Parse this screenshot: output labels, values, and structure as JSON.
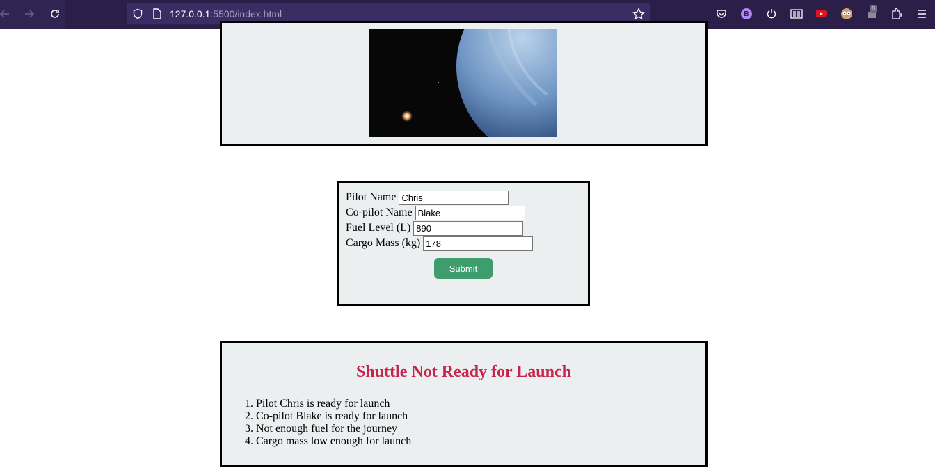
{
  "browser": {
    "url_host": "127.0.0.1",
    "url_rest": ":5500/index.html",
    "profile_initial": "B",
    "extension_badge_count": "0",
    "icons": [
      "back-arrow-icon",
      "forward-arrow-icon",
      "reload-icon",
      "shield-icon",
      "page-icon",
      "bookmark-star-icon",
      "pocket-icon",
      "profile-b-icon",
      "power-icon",
      "reader-view-icon",
      "youtube-icon",
      "owl-extension-icon",
      "extension-count-icon",
      "extensions-puzzle-icon",
      "menu-icon"
    ]
  },
  "form": {
    "pilot_label": "Pilot Name",
    "pilot_value": "Chris",
    "copilot_label": "Co-pilot Name",
    "copilot_value": "Blake",
    "fuel_label": "Fuel Level (L)",
    "fuel_value": "890",
    "cargo_label": "Cargo Mass (kg)",
    "cargo_value": "178",
    "submit_label": "Submit"
  },
  "status": {
    "title": "Shuttle Not Ready for Launch",
    "title_color": "#c7254e",
    "items": [
      "1. Pilot Chris is ready for launch",
      "2. Co-pilot Blake is ready for launch",
      "3. Not enough fuel for the journey",
      "4. Cargo mass low enough for launch"
    ]
  },
  "colors": {
    "toolbar_bg": "#2b1f4a",
    "panel_bg": "#ebeff0",
    "submit_bg": "#3f9d6d"
  }
}
